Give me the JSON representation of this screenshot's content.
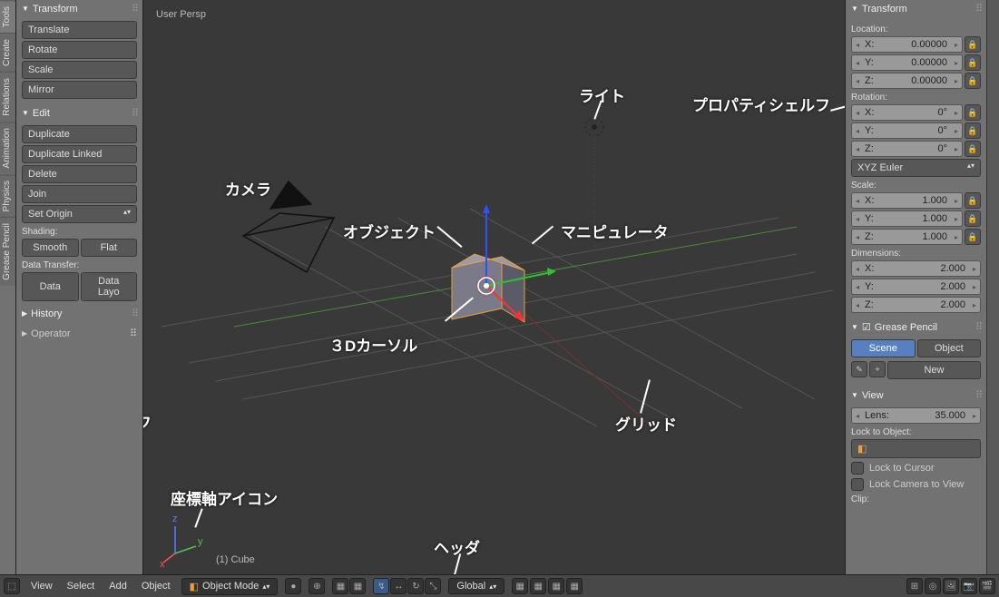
{
  "side_tabs": [
    "Tools",
    "Create",
    "Relations",
    "Animation",
    "Physics",
    "Grease Pencil"
  ],
  "tool_shelf": {
    "transform": {
      "title": "Transform",
      "items": [
        "Translate",
        "Rotate",
        "Scale",
        "Mirror"
      ]
    },
    "edit": {
      "title": "Edit",
      "duplicate": "Duplicate",
      "duplicate_linked": "Duplicate Linked",
      "delete": "Delete",
      "join": "Join",
      "set_origin": "Set Origin",
      "shading_label": "Shading:",
      "smooth": "Smooth",
      "flat": "Flat",
      "data_transfer_label": "Data Transfer:",
      "data": "Data",
      "data_layo": "Data Layo"
    },
    "history": {
      "title": "History"
    },
    "operator": {
      "title": "Operator"
    }
  },
  "viewport": {
    "label": "User Persp",
    "object_label": "(1) Cube"
  },
  "annotations": {
    "light": "ライト",
    "props_shelf": "プロパティシェルフ",
    "camera": "カメラ",
    "object": "オブジェクト",
    "manipulator": "マニピュレータ",
    "cursor3d": "３Dカーソル",
    "tool_shelf": "ツールシェルフ",
    "axis_icon": "座標軸アイコン",
    "header": "ヘッダ",
    "grid": "グリッド"
  },
  "props": {
    "transform": {
      "title": "Transform",
      "location_label": "Location:",
      "rotation_label": "Rotation:",
      "scale_label": "Scale:",
      "dim_label": "Dimensions:",
      "loc": {
        "x": "0.00000",
        "y": "0.00000",
        "z": "0.00000"
      },
      "rot": {
        "x": "0°",
        "y": "0°",
        "z": "0°"
      },
      "rot_mode": "XYZ Euler",
      "scale": {
        "x": "1.000",
        "y": "1.000",
        "z": "1.000"
      },
      "dim": {
        "x": "2.000",
        "y": "2.000",
        "z": "2.000"
      }
    },
    "grease": {
      "title": "Grease Pencil",
      "scene": "Scene",
      "object": "Object",
      "new": "New"
    },
    "view": {
      "title": "View",
      "lens_label": "Lens:",
      "lens": "35.000",
      "lock_label": "Lock to Object:",
      "lock_cursor": "Lock to Cursor",
      "lock_camera": "Lock Camera to View",
      "clip": "Clip:"
    }
  },
  "footer": {
    "view": "View",
    "select": "Select",
    "add": "Add",
    "object": "Object",
    "mode": "Object Mode",
    "global": "Global"
  }
}
